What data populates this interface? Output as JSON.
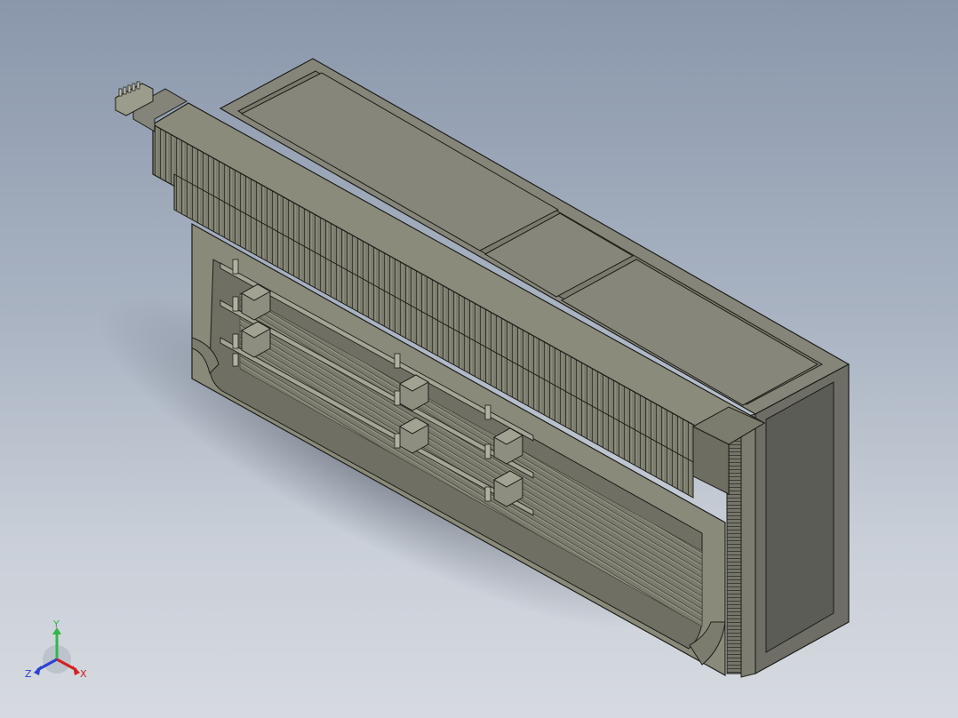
{
  "viewport": {
    "background_top": "#8a97ab",
    "background_bottom": "#d6dae0",
    "model": "heatsink-enclosure-assembly"
  },
  "triad": {
    "x_label": "X",
    "y_label": "Y",
    "z_label": "Z",
    "x_color": "#d42020",
    "y_color": "#2fb84a",
    "z_color": "#2a3fd6"
  },
  "colors": {
    "part_light": "#8b8b78",
    "part_mid": "#77776a",
    "part_dark": "#5a5a52",
    "edge": "#1e1e1a"
  }
}
